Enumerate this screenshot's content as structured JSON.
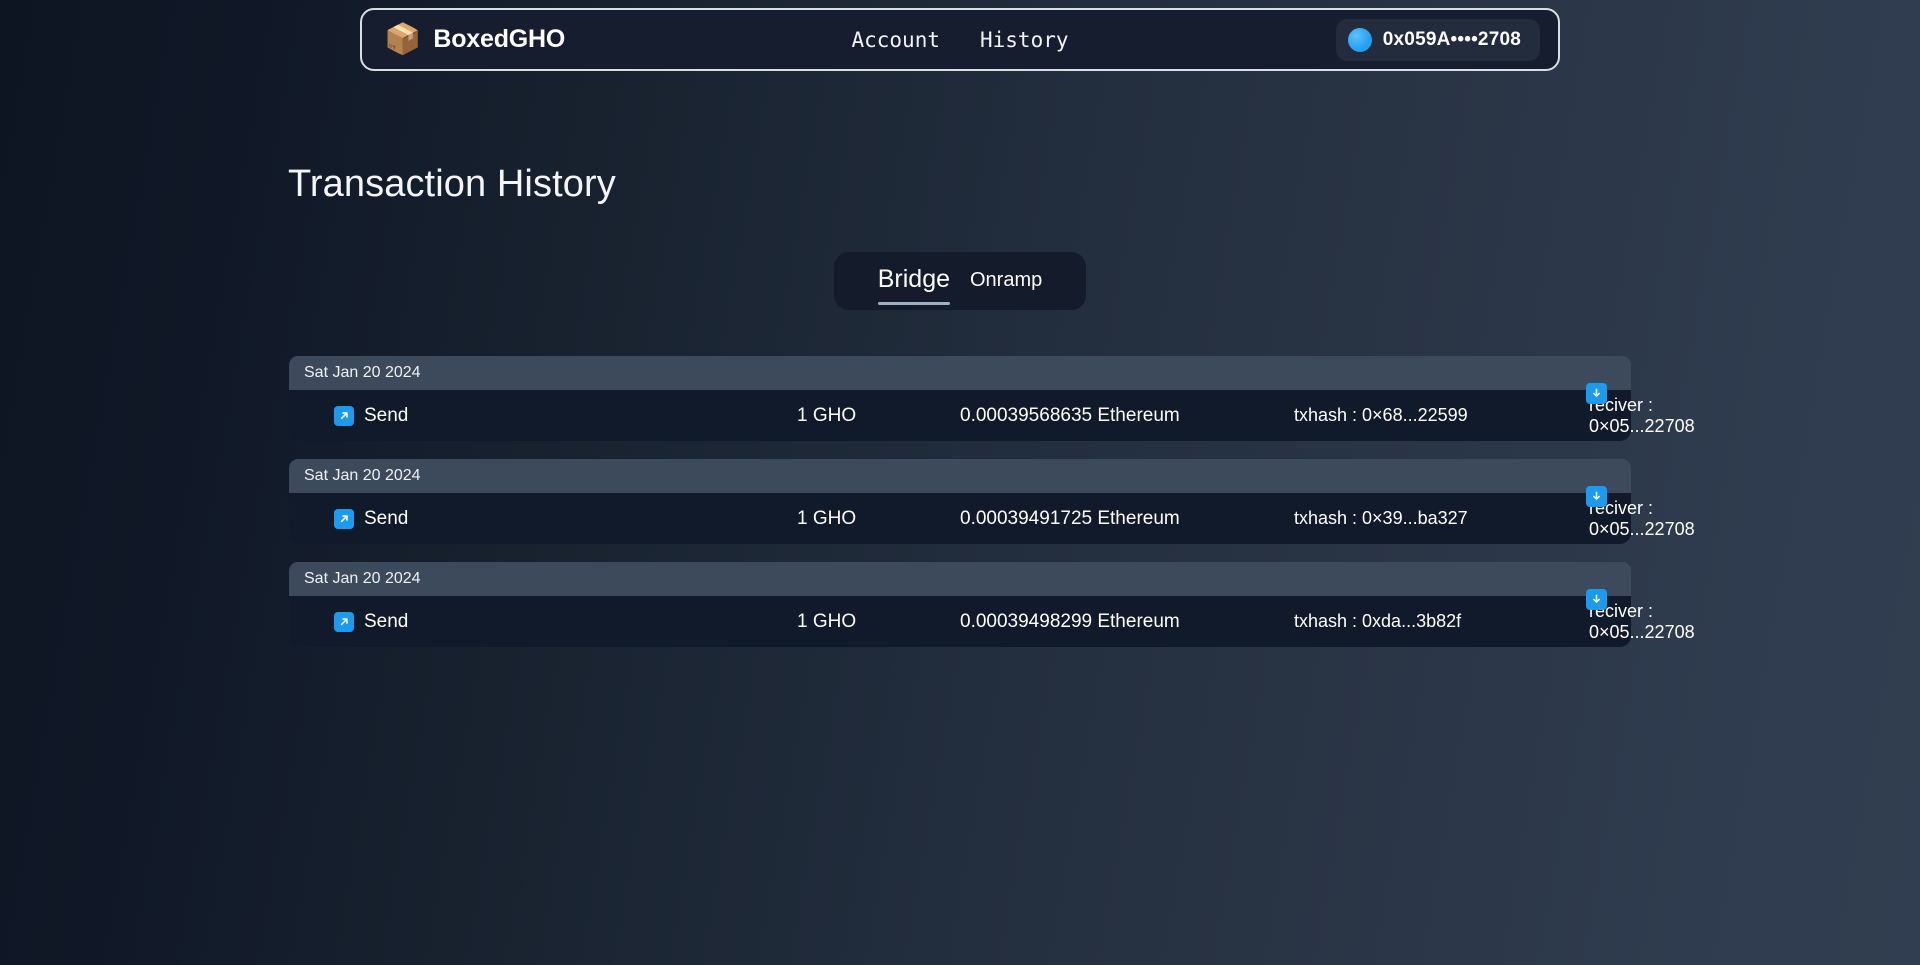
{
  "navbar": {
    "logo_icon": "package-box-icon",
    "brand_name": "BoxedGHO",
    "links": [
      {
        "label": "Account"
      },
      {
        "label": "History"
      }
    ],
    "wallet": {
      "avatar_icon": "wallet-avatar-circle",
      "address": "0x059A••••2708",
      "accent_color": "#2aa3f5"
    }
  },
  "page": {
    "title": "Transaction History"
  },
  "tabs": {
    "items": [
      {
        "label": "Bridge",
        "active": true
      },
      {
        "label": "Onramp",
        "active": false
      }
    ],
    "underline_color": "#9fb0c4"
  },
  "transactions": {
    "download_icon": "download-icon",
    "send_icon": "arrow-up-right-icon",
    "accent_color": "#1c9bee",
    "date_header_bg": "#3c4a5c",
    "row_bg": "#111a2b",
    "groups": [
      {
        "date": "Sat Jan 20 2024",
        "type": "Send",
        "amount": "1 GHO",
        "fee": "0.00039568635 Ethereum",
        "txhash": "txhash : 0×68...22599",
        "receiver": "reciver : 0×05...22708"
      },
      {
        "date": "Sat Jan 20 2024",
        "type": "Send",
        "amount": "1 GHO",
        "fee": "0.00039491725 Ethereum",
        "txhash": "txhash : 0×39...ba327",
        "receiver": "reciver : 0×05...22708"
      },
      {
        "date": "Sat Jan 20 2024",
        "type": "Send",
        "amount": "1 GHO",
        "fee": "0.00039498299 Ethereum",
        "txhash": "txhash : 0xda...3b82f",
        "receiver": "reciver : 0×05...22708"
      }
    ]
  }
}
